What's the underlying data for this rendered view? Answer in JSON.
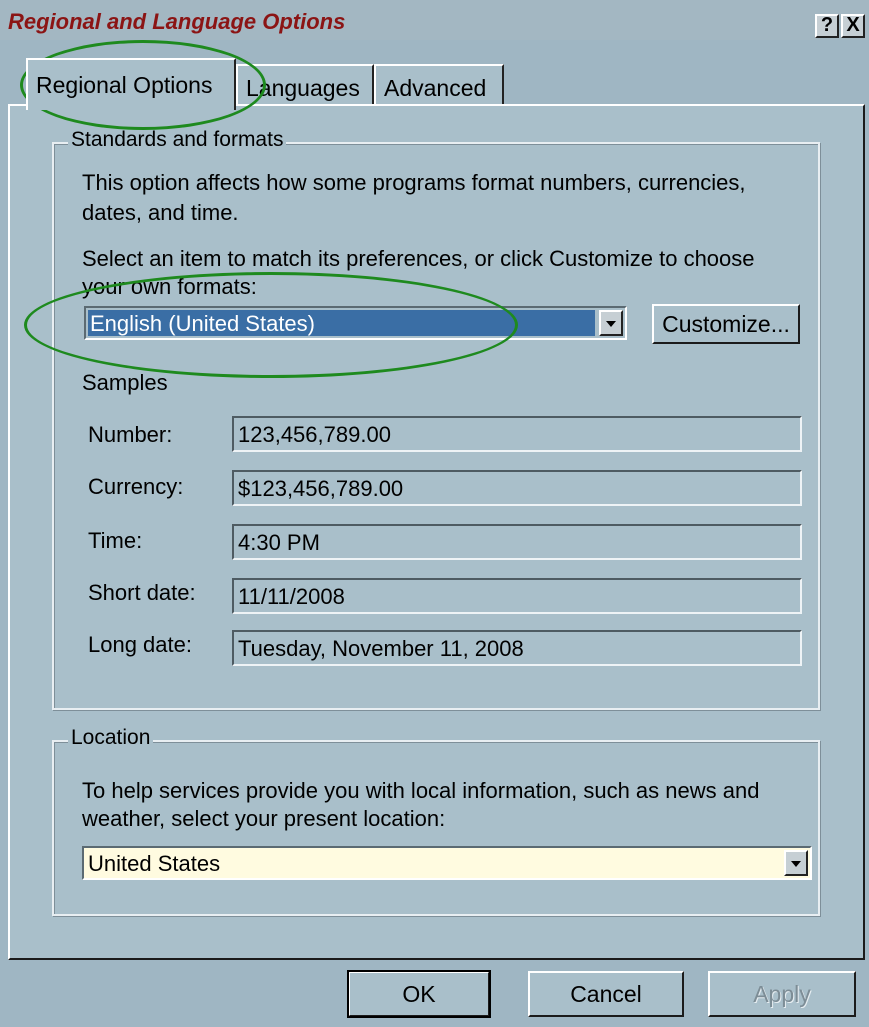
{
  "window": {
    "title": "Regional and Language Options",
    "help_button": "?",
    "close_button": "X"
  },
  "tabs": [
    {
      "label": "Regional Options",
      "active": true
    },
    {
      "label": "Languages",
      "active": false
    },
    {
      "label": "Advanced",
      "active": false
    }
  ],
  "standards": {
    "group_label": "Standards and formats",
    "desc_line1": "This option affects how some programs format numbers, currencies,",
    "desc_line2": "dates, and time.",
    "select_line1": "Select an item to match its preferences, or click Customize to choose",
    "select_line2": "your own formats:",
    "format_value": "English (United States)",
    "customize_label": "Customize...",
    "samples_label": "Samples",
    "samples": [
      {
        "label": "Number:",
        "value": "123,456,789.00"
      },
      {
        "label": "Currency:",
        "value": "$123,456,789.00"
      },
      {
        "label": "Time:",
        "value": "4:30 PM"
      },
      {
        "label": "Short date:",
        "value": "11/11/2008"
      },
      {
        "label": "Long date:",
        "value": "Tuesday, November 11, 2008"
      }
    ]
  },
  "location": {
    "group_label": "Location",
    "desc_line1": "To help services provide you with local information, such as news and",
    "desc_line2": "weather, select your present location:",
    "value": "United States"
  },
  "buttons": {
    "ok": "OK",
    "cancel": "Cancel",
    "apply": "Apply"
  },
  "colors": {
    "title_text": "#8b1414",
    "highlight_circle": "#1e8a1e",
    "selection": "#3a6ea5",
    "location_field": "#fffbe0"
  }
}
